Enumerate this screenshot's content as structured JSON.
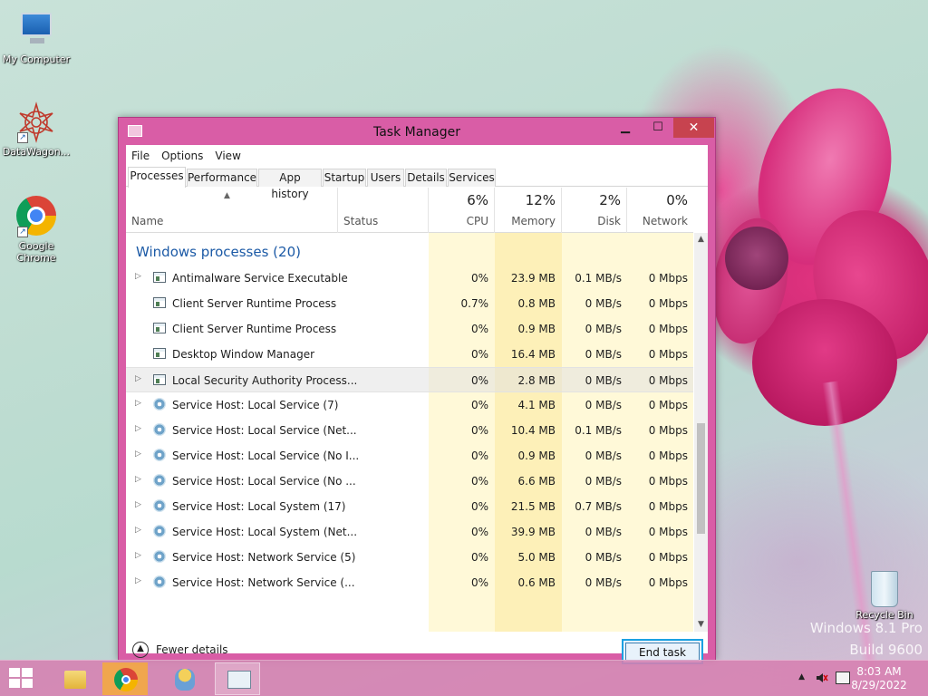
{
  "desktop": {
    "icons": [
      {
        "label": "My Computer"
      },
      {
        "label": "DataWagon..."
      },
      {
        "label": "Google Chrome"
      }
    ],
    "recycle_bin": "Recycle Bin",
    "watermark_line1": "Windows 8.1 Pro",
    "watermark_line2": "Build 9600"
  },
  "window": {
    "title": "Task Manager",
    "controls": {
      "minimize": "▁",
      "maximize": "☐",
      "close": "✕"
    },
    "menu": [
      "File",
      "Options",
      "View"
    ],
    "tabs": [
      "Processes",
      "Performance",
      "App history",
      "Startup",
      "Users",
      "Details",
      "Services"
    ],
    "active_tab": "Processes",
    "columns": {
      "name": "Name",
      "status": "Status",
      "cpu": {
        "percent": "6%",
        "label": "CPU"
      },
      "memory": {
        "percent": "12%",
        "label": "Memory"
      },
      "disk": {
        "percent": "2%",
        "label": "Disk"
      },
      "network": {
        "percent": "0%",
        "label": "Network"
      }
    },
    "group_title": "Windows processes (20)",
    "processes": [
      {
        "name": "Antimalware Service Executable",
        "cpu": "0%",
        "memory": "23.9 MB",
        "disk": "0.1 MB/s",
        "network": "0 Mbps",
        "expandable": true,
        "icon": "app-window-icon"
      },
      {
        "name": "Client Server Runtime Process",
        "cpu": "0.7%",
        "memory": "0.8 MB",
        "disk": "0 MB/s",
        "network": "0 Mbps",
        "expandable": false,
        "icon": "app-window-icon"
      },
      {
        "name": "Client Server Runtime Process",
        "cpu": "0%",
        "memory": "0.9 MB",
        "disk": "0 MB/s",
        "network": "0 Mbps",
        "expandable": false,
        "icon": "app-window-icon"
      },
      {
        "name": "Desktop Window Manager",
        "cpu": "0%",
        "memory": "16.4 MB",
        "disk": "0 MB/s",
        "network": "0 Mbps",
        "expandable": false,
        "icon": "app-window-icon"
      },
      {
        "name": "Local Security Authority Process...",
        "cpu": "0%",
        "memory": "2.8 MB",
        "disk": "0 MB/s",
        "network": "0 Mbps",
        "expandable": true,
        "icon": "app-window-icon"
      },
      {
        "name": "Service Host: Local Service (7)",
        "cpu": "0%",
        "memory": "4.1 MB",
        "disk": "0 MB/s",
        "network": "0 Mbps",
        "expandable": true,
        "icon": "gear-icon"
      },
      {
        "name": "Service Host: Local Service (Net...",
        "cpu": "0%",
        "memory": "10.4 MB",
        "disk": "0.1 MB/s",
        "network": "0 Mbps",
        "expandable": true,
        "icon": "gear-icon"
      },
      {
        "name": "Service Host: Local Service (No I...",
        "cpu": "0%",
        "memory": "0.9 MB",
        "disk": "0 MB/s",
        "network": "0 Mbps",
        "expandable": true,
        "icon": "gear-icon"
      },
      {
        "name": "Service Host: Local Service (No ...",
        "cpu": "0%",
        "memory": "6.6 MB",
        "disk": "0 MB/s",
        "network": "0 Mbps",
        "expandable": true,
        "icon": "gear-icon"
      },
      {
        "name": "Service Host: Local System (17)",
        "cpu": "0%",
        "memory": "21.5 MB",
        "disk": "0.7 MB/s",
        "network": "0 Mbps",
        "expandable": true,
        "icon": "gear-icon"
      },
      {
        "name": "Service Host: Local System (Net...",
        "cpu": "0%",
        "memory": "39.9 MB",
        "disk": "0 MB/s",
        "network": "0 Mbps",
        "expandable": true,
        "icon": "gear-icon"
      },
      {
        "name": "Service Host: Network Service (5)",
        "cpu": "0%",
        "memory": "5.0 MB",
        "disk": "0 MB/s",
        "network": "0 Mbps",
        "expandable": true,
        "icon": "gear-icon"
      },
      {
        "name": "Service Host: Network Service (...",
        "cpu": "0%",
        "memory": "0.6 MB",
        "disk": "0 MB/s",
        "network": "0 Mbps",
        "expandable": true,
        "icon": "gear-icon"
      }
    ],
    "selected_row_index": 4,
    "fewer_details": "Fewer details",
    "end_task": "End task"
  },
  "taskbar": {
    "time": "8:03 AM",
    "date": "8/29/2022"
  },
  "colors": {
    "window_frame": "#d95da6",
    "group_title": "#1c5aa6",
    "heat_light": "#fff9d8",
    "heat_medium": "#fdf0b8",
    "close_button": "#c7434f",
    "focus_accent": "#1ba1e2"
  }
}
